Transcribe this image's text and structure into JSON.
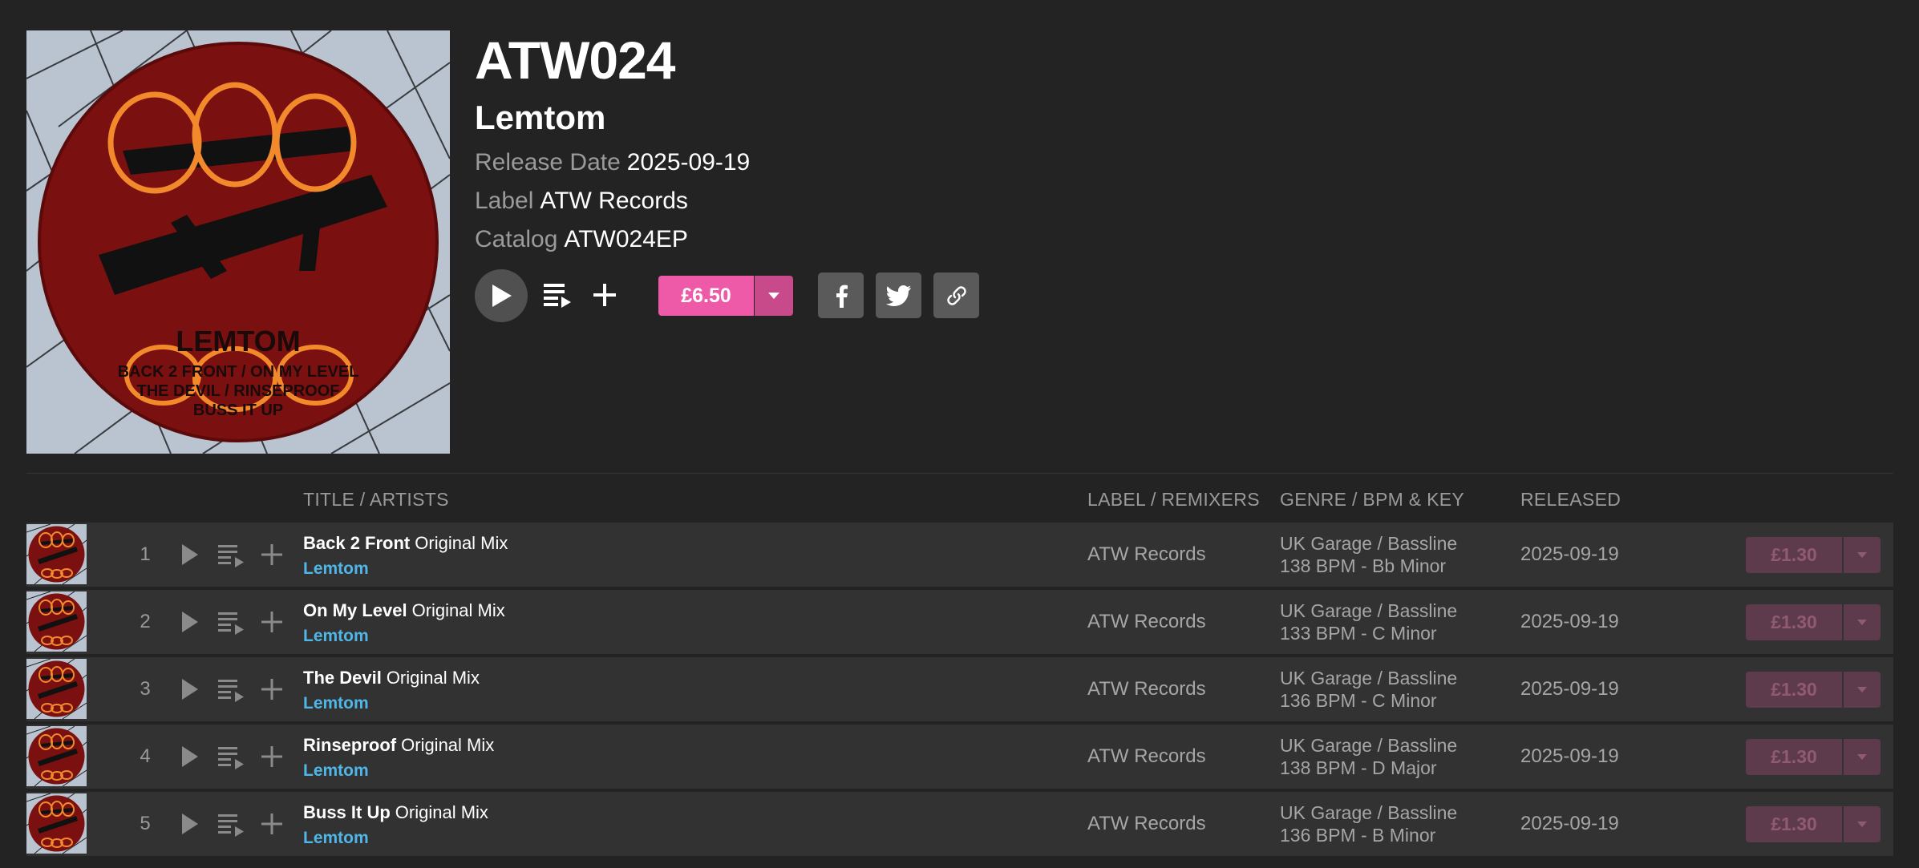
{
  "release": {
    "catalog_title": "ATW024",
    "artist": "Lemtom",
    "release_date_label": "Release Date",
    "release_date": "2025-09-19",
    "label_label": "Label",
    "label": "ATW Records",
    "catalog_label": "Catalog",
    "catalog": "ATW024EP",
    "price": "£6.50",
    "artwork_text": [
      "LEMTOM",
      "BACK 2 FRONT / ON MY LEVEL",
      "THE DEVIL / RINSEPROOF",
      "BUSS IT UP"
    ]
  },
  "colors": {
    "background": "#232323",
    "row_background": "#323232",
    "accent_pink": "#ee5aa8",
    "artist_link": "#4fb7e8",
    "muted_text": "#9a9a9a"
  },
  "icons": {
    "play": "play-icon",
    "queue": "add-to-queue-icon",
    "add": "plus-icon",
    "facebook": "facebook-icon",
    "twitter": "twitter-icon",
    "link": "link-icon",
    "dropdown": "chevron-down-icon"
  },
  "table": {
    "headers": {
      "title": "TITLE / ARTISTS",
      "label": "LABEL / REMIXERS",
      "genre": "GENRE / BPM & KEY",
      "released": "RELEASED"
    },
    "tracks": [
      {
        "num": "1",
        "title": "Back 2 Front",
        "mix": "Original Mix",
        "artist": "Lemtom",
        "label": "ATW Records",
        "genre": "UK Garage / Bassline",
        "bpm_key": "138 BPM - Bb Minor",
        "released": "2025-09-19",
        "price": "£1.30"
      },
      {
        "num": "2",
        "title": "On My Level",
        "mix": "Original Mix",
        "artist": "Lemtom",
        "label": "ATW Records",
        "genre": "UK Garage / Bassline",
        "bpm_key": "133 BPM - C Minor",
        "released": "2025-09-19",
        "price": "£1.30"
      },
      {
        "num": "3",
        "title": "The Devil",
        "mix": "Original Mix",
        "artist": "Lemtom",
        "label": "ATW Records",
        "genre": "UK Garage / Bassline",
        "bpm_key": "136 BPM - C Minor",
        "released": "2025-09-19",
        "price": "£1.30"
      },
      {
        "num": "4",
        "title": "Rinseproof",
        "mix": "Original Mix",
        "artist": "Lemtom",
        "label": "ATW Records",
        "genre": "UK Garage / Bassline",
        "bpm_key": "138 BPM - D Major",
        "released": "2025-09-19",
        "price": "£1.30"
      },
      {
        "num": "5",
        "title": "Buss It Up",
        "mix": "Original Mix",
        "artist": "Lemtom",
        "label": "ATW Records",
        "genre": "UK Garage / Bassline",
        "bpm_key": "136 BPM - B Minor",
        "released": "2025-09-19",
        "price": "£1.30"
      }
    ]
  }
}
